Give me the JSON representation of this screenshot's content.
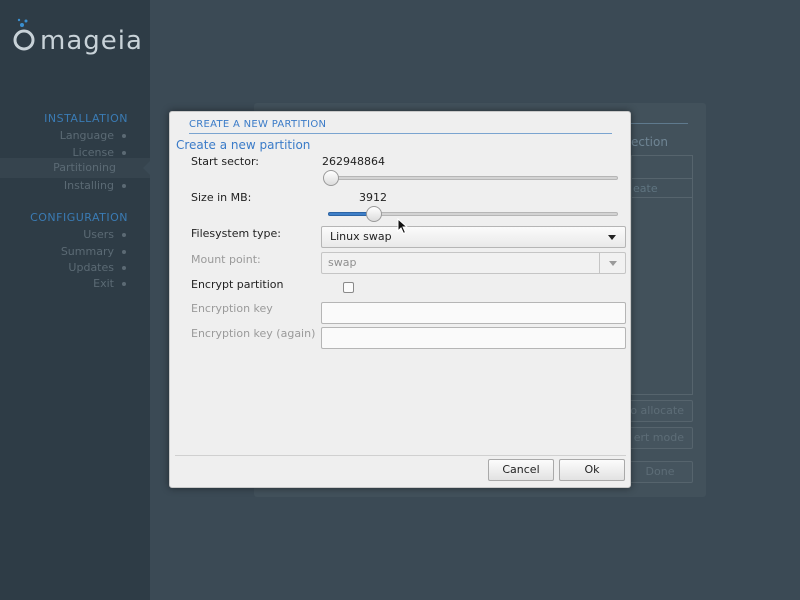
{
  "brand": {
    "logo_text": "mageia"
  },
  "sidebar": {
    "sections": [
      {
        "title": "INSTALLATION",
        "items": [
          "Language",
          "License",
          "Partitioning",
          "Installing"
        ]
      },
      {
        "title": "CONFIGURATION",
        "items": [
          "Users",
          "Summary",
          "Updates",
          "Exit"
        ]
      }
    ],
    "active_item": "Partitioning"
  },
  "background_panel": {
    "partial_heading": "ection",
    "partial_column": "eate",
    "button_auto_allocate": "o allocate",
    "button_expert_mode": "ert mode",
    "button_done": "Done"
  },
  "dialog": {
    "title": "CREATE A NEW PARTITION",
    "subtitle": "Create a new partition",
    "start_sector": {
      "label": "Start sector:",
      "value": "262948864",
      "slider_fraction": 0.0
    },
    "size": {
      "label": "Size in MB:",
      "value": "3912",
      "slider_fraction": 0.14
    },
    "filesystem": {
      "label": "Filesystem type:",
      "selected": "Linux swap"
    },
    "mount_point": {
      "label": "Mount point:",
      "value": "swap"
    },
    "encrypt": {
      "label": "Encrypt partition",
      "checked": false
    },
    "encryption_key": {
      "label": "Encryption key",
      "value": ""
    },
    "encryption_key_again": {
      "label": "Encryption key (again)",
      "value": ""
    },
    "buttons": {
      "cancel": "Cancel",
      "ok": "Ok"
    }
  },
  "colors": {
    "accent": "#3a7bc8",
    "sidebar_bg": "#2e3c46",
    "main_bg": "#3b4a55",
    "dialog_bg": "#efefef"
  }
}
